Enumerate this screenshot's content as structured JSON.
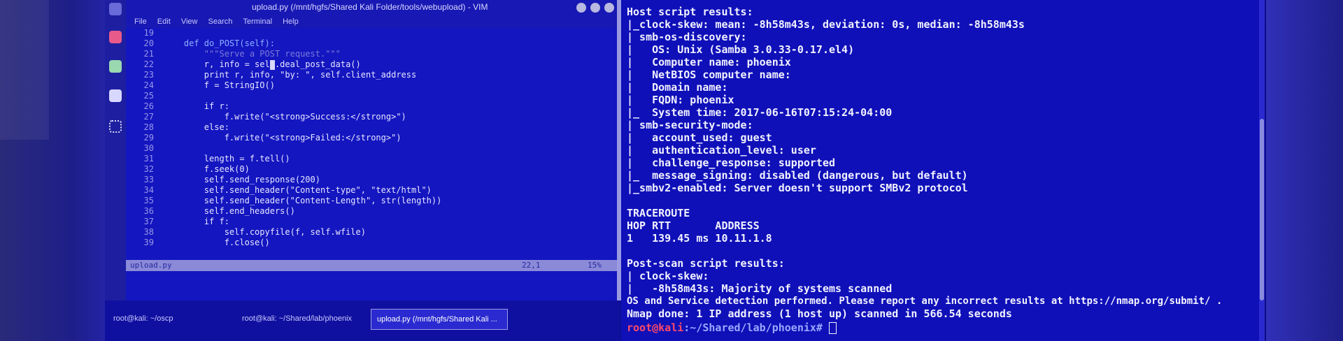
{
  "vim": {
    "title": "upload.py (/mnt/hgfs/Shared Kali Folder/tools/webupload) - VIM",
    "menu": [
      "File",
      "Edit",
      "View",
      "Search",
      "Terminal",
      "Help"
    ],
    "status_file": "upload.py",
    "status_pos": "22,1",
    "status_pct": "15%",
    "lines": [
      {
        "n": "19",
        "text": ""
      },
      {
        "n": "20",
        "text": "    def do_POST(self):"
      },
      {
        "n": "21",
        "text": "        \"\"\"Serve a POST request.\"\"\""
      },
      {
        "n": "22",
        "text": "        r, info = self.deal_post_data()"
      },
      {
        "n": "23",
        "text": "        print r, info, \"by: \", self.client_address"
      },
      {
        "n": "24",
        "text": "        f = StringIO()"
      },
      {
        "n": "25",
        "text": ""
      },
      {
        "n": "26",
        "text": "        if r:"
      },
      {
        "n": "27",
        "text": "            f.write(\"<strong>Success:</strong>\")"
      },
      {
        "n": "28",
        "text": "        else:"
      },
      {
        "n": "29",
        "text": "            f.write(\"<strong>Failed:</strong>\")"
      },
      {
        "n": "30",
        "text": ""
      },
      {
        "n": "31",
        "text": "        length = f.tell()"
      },
      {
        "n": "32",
        "text": "        f.seek(0)"
      },
      {
        "n": "33",
        "text": "        self.send_response(200)"
      },
      {
        "n": "34",
        "text": "        self.send_header(\"Content-type\", \"text/html\")"
      },
      {
        "n": "35",
        "text": "        self.send_header(\"Content-Length\", str(length))"
      },
      {
        "n": "36",
        "text": "        self.end_headers()"
      },
      {
        "n": "37",
        "text": "        if f:"
      },
      {
        "n": "38",
        "text": "            self.copyfile(f, self.wfile)"
      },
      {
        "n": "39",
        "text": "            f.close()"
      }
    ]
  },
  "taskbar": {
    "tasks": [
      "root@kali: ~/oscp",
      "root@kali: ~/Shared/lab/phoenix",
      "upload.py (/mnt/hgfs/Shared Kali ..."
    ]
  },
  "terminal": {
    "lines": [
      "Host script results:",
      "|_clock-skew: mean: -8h58m43s, deviation: 0s, median: -8h58m43s",
      "| smb-os-discovery:",
      "|   OS: Unix (Samba 3.0.33-0.17.el4)",
      "|   Computer name: phoenix",
      "|   NetBIOS computer name:",
      "|   Domain name:",
      "|   FQDN: phoenix",
      "|_  System time: 2017-06-16T07:15:24-04:00",
      "| smb-security-mode:",
      "|   account_used: guest",
      "|   authentication_level: user",
      "|   challenge_response: supported",
      "|_  message_signing: disabled (dangerous, but default)",
      "|_smbv2-enabled: Server doesn't support SMBv2 protocol",
      "",
      "TRACEROUTE",
      "HOP RTT       ADDRESS",
      "1   139.45 ms 10.11.1.8",
      "",
      "Post-scan script results:",
      "| clock-skew:",
      "|   -8h58m43s: Majority of systems scanned",
      "OS and Service detection performed. Please report any incorrect results at https://nmap.org/submit/ .",
      "Nmap done: 1 IP address (1 host up) scanned in 566.54 seconds"
    ],
    "prompt_user": "root@kali",
    "prompt_path": ":~/Shared/lab/phoenix# "
  }
}
